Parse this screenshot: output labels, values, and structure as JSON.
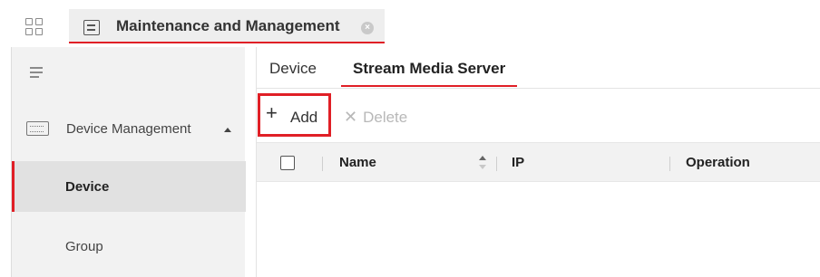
{
  "titlebar": {
    "tab_title": "Maintenance and Management",
    "accent_color": "#e01f26"
  },
  "icons": {
    "app_grid": "grid-icon",
    "tab": "maintenance-icon",
    "tab_close": "close-icon",
    "menu": "hamburger-icon",
    "device_management": "device-management-icon",
    "collapse": "caret-up-icon",
    "add": "plus-icon",
    "delete": "x-icon",
    "sort": "sort-icon"
  },
  "sidebar": {
    "section_label": "Device Management",
    "items": [
      {
        "label": "Device",
        "active": true
      },
      {
        "label": "Group",
        "active": false
      }
    ]
  },
  "main": {
    "tabs": [
      {
        "label": "Device",
        "active": false
      },
      {
        "label": "Stream Media Server",
        "active": true
      }
    ],
    "toolbar": {
      "add_label": "Add",
      "delete_label": "Delete"
    },
    "table": {
      "columns": [
        "Name",
        "IP",
        "Operation"
      ],
      "rows": []
    }
  }
}
